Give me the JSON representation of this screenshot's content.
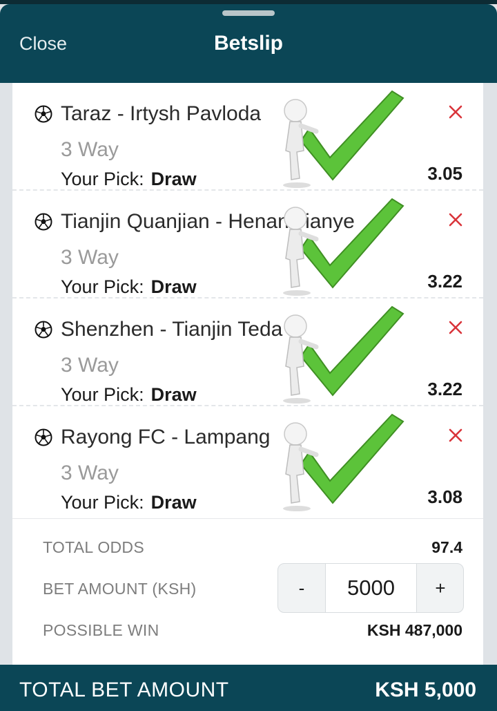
{
  "header": {
    "close_label": "Close",
    "title": "Betslip"
  },
  "bets": [
    {
      "match": "Taraz - Irtysh Pavloda",
      "market": "3 Way",
      "pick_label": "Your Pick:",
      "pick": "Draw",
      "odds": "3.05"
    },
    {
      "match": "Tianjin Quanjian - Henan Jianye",
      "market": "3 Way",
      "pick_label": "Your Pick:",
      "pick": "Draw",
      "odds": "3.22"
    },
    {
      "match": "Shenzhen - Tianjin Teda",
      "market": "3 Way",
      "pick_label": "Your Pick:",
      "pick": "Draw",
      "odds": "3.22"
    },
    {
      "match": "Rayong FC - Lampang",
      "market": "3 Way",
      "pick_label": "Your Pick:",
      "pick": "Draw",
      "odds": "3.08"
    }
  ],
  "summary": {
    "total_odds_label": "TOTAL ODDS",
    "total_odds": "97.4",
    "bet_amount_label": "BET AMOUNT (KSH)",
    "bet_amount": "5000",
    "minus_label": "-",
    "plus_label": "+",
    "possible_win_label": "POSSIBLE WIN",
    "possible_win": "KSH 487,000"
  },
  "footer": {
    "label": "TOTAL BET AMOUNT",
    "value": "KSH 5,000"
  },
  "icons": {
    "sport": "soccer-ball-icon",
    "remove": "close-x-icon",
    "overlay": "checkmark-figure-sticker"
  },
  "colors": {
    "header": "#0b4656",
    "remove": "#d9343a",
    "check": "#5cc33a"
  }
}
